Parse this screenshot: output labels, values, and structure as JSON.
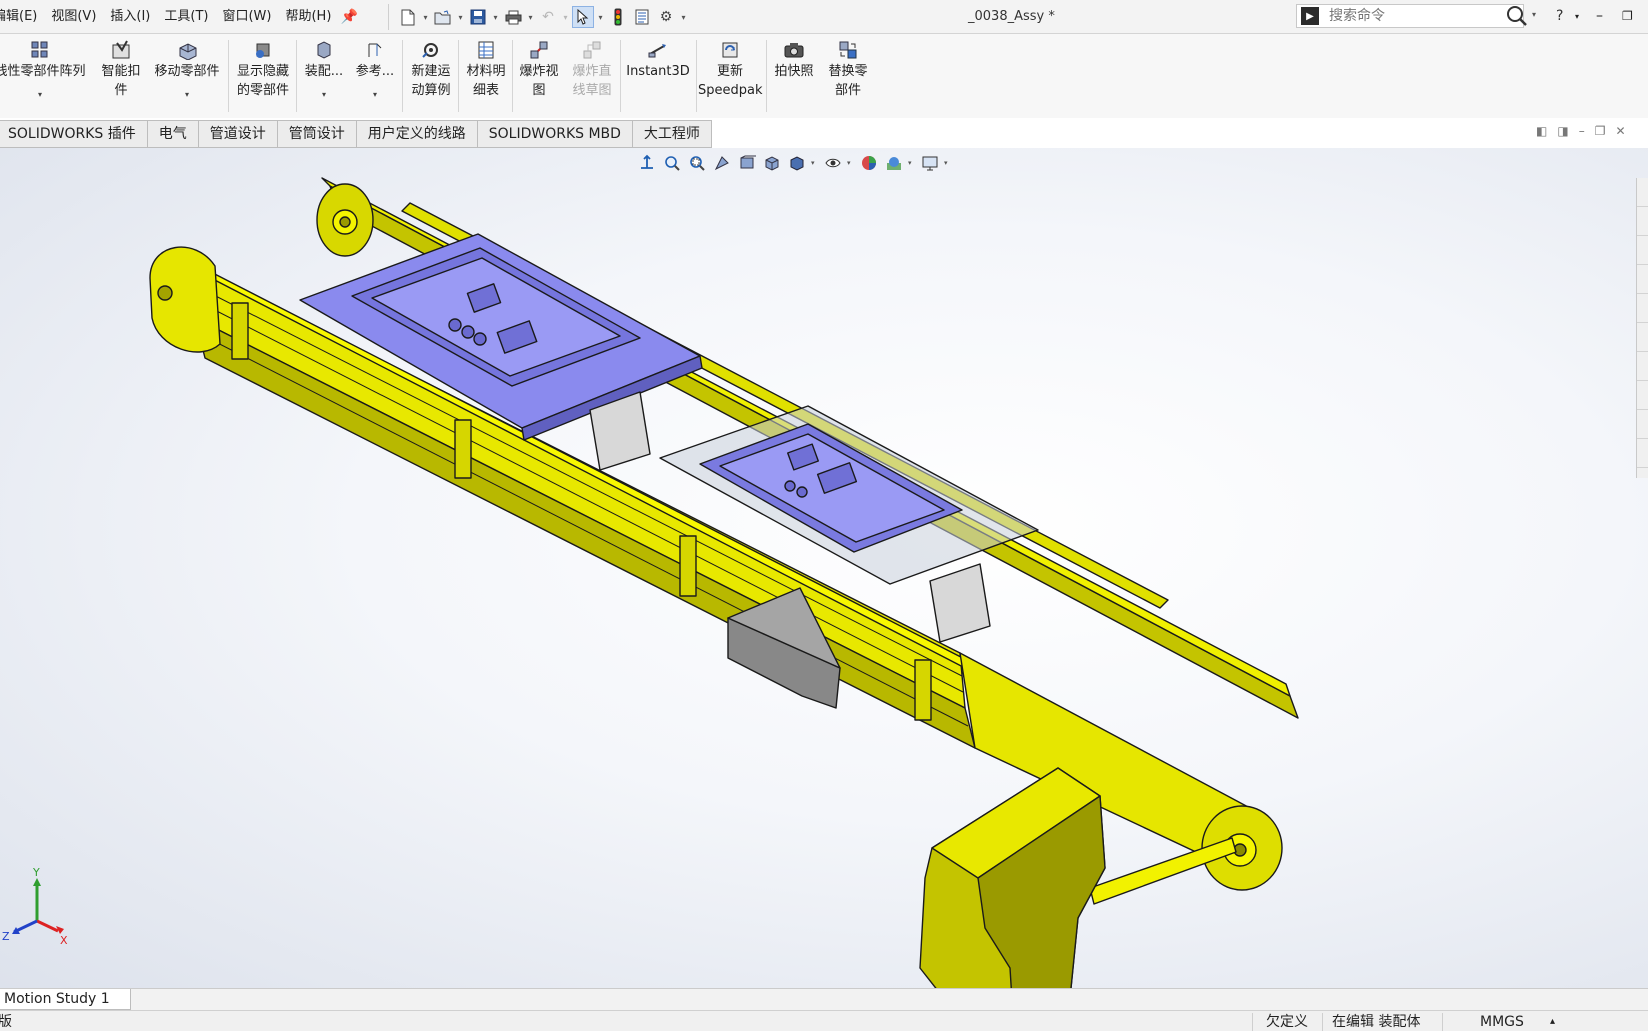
{
  "menu": {
    "items": [
      "编辑(E)",
      "视图(V)",
      "插入(I)",
      "工具(T)",
      "窗口(W)",
      "帮助(H)"
    ]
  },
  "document": {
    "title": "_0038_Assy *"
  },
  "search": {
    "placeholder": "搜索命令"
  },
  "help_label": "?",
  "ribbon": {
    "linear_pattern": "线性零部件阵列",
    "smart_fasteners_1": "智能扣",
    "smart_fasteners_2": "件",
    "move_component": "移动零部件",
    "show_hidden_1": "显示隐藏",
    "show_hidden_2": "的零部件",
    "assembly_features": "装配...",
    "reference_geometry": "参考...",
    "new_motion_1": "新建运",
    "new_motion_2": "动算例",
    "bom_1": "材料明",
    "bom_2": "细表",
    "exploded_view_1": "爆炸视",
    "exploded_view_2": "图",
    "explode_line_1": "爆炸直",
    "explode_line_2": "线草图",
    "instant3d": "Instant3D",
    "update_speedpak_1": "更新",
    "update_speedpak_2": "Speedpak",
    "snapshot": "拍快照",
    "replace_1": "替换零",
    "replace_2": "部件"
  },
  "tabs": [
    "SOLIDWORKS 插件",
    "电气",
    "管道设计",
    "管筒设计",
    "用户定义的线路",
    "SOLIDWORKS MBD",
    "大工程师"
  ],
  "triad": {
    "x": "X",
    "y": "Y",
    "z": "Z"
  },
  "motion_tab": "Motion Study 1",
  "status": {
    "left": "版",
    "under_defined": "欠定义",
    "editing": "在编辑 装配体",
    "units": "MMGS",
    "units_caret": "▴"
  },
  "colors": {
    "frame_yellow": "#e6e600",
    "fixture_blue": "#8080e6",
    "viewport_bg": "#f4f6fa",
    "edge": "#1a1a1a"
  },
  "icons": [
    "new-document-icon",
    "open-icon",
    "save-icon",
    "print-icon",
    "undo-icon",
    "select-icon",
    "rebuild-icon",
    "file-properties-icon",
    "options-icon",
    "search-icon"
  ]
}
